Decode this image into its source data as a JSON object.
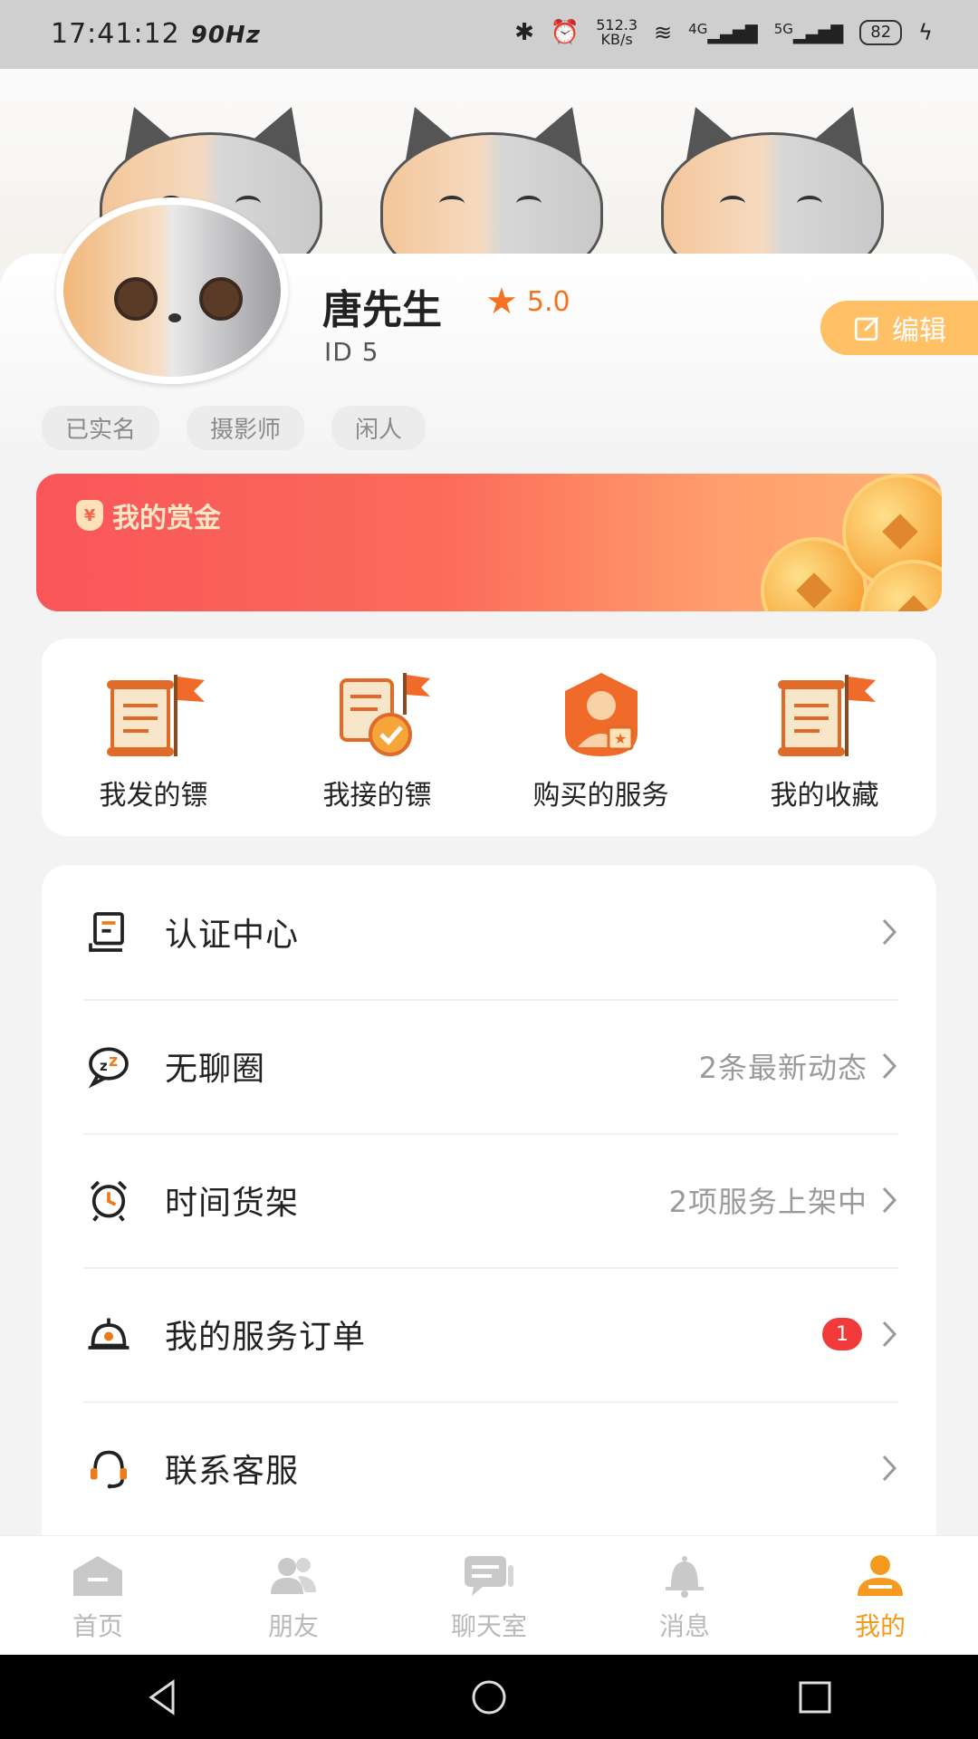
{
  "status_bar": {
    "time": "17:41:12",
    "refresh_rate": "90Hz",
    "speed_value": "512.3",
    "speed_unit": "KB/s",
    "network_1": "4G",
    "network_2": "5G",
    "battery": "82"
  },
  "profile": {
    "name": "唐先生",
    "rating": "5.0",
    "user_id": "ID 5",
    "edit_label": "编辑",
    "tags": [
      "已实名",
      "摄影师",
      "闲人"
    ]
  },
  "bounty": {
    "title": "我的赏金",
    "bag_symbol": "¥"
  },
  "quick_actions": [
    {
      "label": "我发的镖",
      "icon": "scroll-flag-icon"
    },
    {
      "label": "我接的镖",
      "icon": "scroll-check-icon"
    },
    {
      "label": "购买的服务",
      "icon": "service-person-icon"
    },
    {
      "label": "我的收藏",
      "icon": "scroll-flag-icon"
    }
  ],
  "menu": [
    {
      "label": "认证中心",
      "extra": "",
      "badge": "",
      "icon": "certificate-icon"
    },
    {
      "label": "无聊圈",
      "extra": "2条最新动态",
      "badge": "",
      "icon": "zz-chat-icon"
    },
    {
      "label": "时间货架",
      "extra": "2项服务上架中",
      "badge": "",
      "icon": "alarm-clock-icon"
    },
    {
      "label": "我的服务订单",
      "extra": "",
      "badge": "1",
      "icon": "service-bell-icon"
    },
    {
      "label": "联系客服",
      "extra": "",
      "badge": "",
      "icon": "headset-icon"
    }
  ],
  "tabs": [
    {
      "label": "首页",
      "icon": "home-icon",
      "active": false
    },
    {
      "label": "朋友",
      "icon": "friends-icon",
      "active": false
    },
    {
      "label": "聊天室",
      "icon": "chatroom-icon",
      "active": false
    },
    {
      "label": "消息",
      "icon": "bell-icon",
      "active": false
    },
    {
      "label": "我的",
      "icon": "profile-icon",
      "active": true
    }
  ],
  "colors": {
    "accent_orange": "#f59a1d",
    "bounty_red": "#f9565a",
    "badge_red": "#f23a3a",
    "edit_button": "#ffc066"
  }
}
